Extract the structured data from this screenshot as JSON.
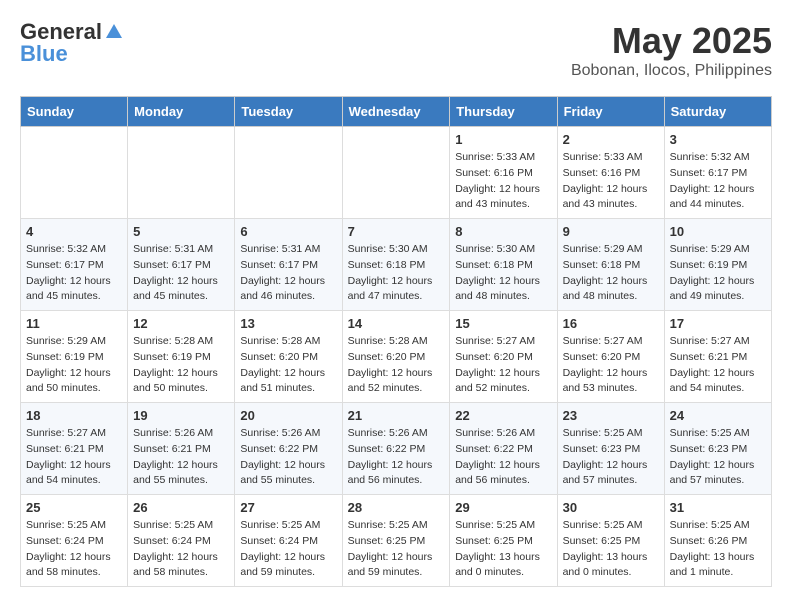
{
  "header": {
    "logo_line1": "General",
    "logo_line2": "Blue",
    "month_title": "May 2025",
    "location": "Bobonan, Ilocos, Philippines"
  },
  "days_of_week": [
    "Sunday",
    "Monday",
    "Tuesday",
    "Wednesday",
    "Thursday",
    "Friday",
    "Saturday"
  ],
  "weeks": [
    [
      {
        "day": "",
        "detail": ""
      },
      {
        "day": "",
        "detail": ""
      },
      {
        "day": "",
        "detail": ""
      },
      {
        "day": "",
        "detail": ""
      },
      {
        "day": "1",
        "detail": "Sunrise: 5:33 AM\nSunset: 6:16 PM\nDaylight: 12 hours\nand 43 minutes."
      },
      {
        "day": "2",
        "detail": "Sunrise: 5:33 AM\nSunset: 6:16 PM\nDaylight: 12 hours\nand 43 minutes."
      },
      {
        "day": "3",
        "detail": "Sunrise: 5:32 AM\nSunset: 6:17 PM\nDaylight: 12 hours\nand 44 minutes."
      }
    ],
    [
      {
        "day": "4",
        "detail": "Sunrise: 5:32 AM\nSunset: 6:17 PM\nDaylight: 12 hours\nand 45 minutes."
      },
      {
        "day": "5",
        "detail": "Sunrise: 5:31 AM\nSunset: 6:17 PM\nDaylight: 12 hours\nand 45 minutes."
      },
      {
        "day": "6",
        "detail": "Sunrise: 5:31 AM\nSunset: 6:17 PM\nDaylight: 12 hours\nand 46 minutes."
      },
      {
        "day": "7",
        "detail": "Sunrise: 5:30 AM\nSunset: 6:18 PM\nDaylight: 12 hours\nand 47 minutes."
      },
      {
        "day": "8",
        "detail": "Sunrise: 5:30 AM\nSunset: 6:18 PM\nDaylight: 12 hours\nand 48 minutes."
      },
      {
        "day": "9",
        "detail": "Sunrise: 5:29 AM\nSunset: 6:18 PM\nDaylight: 12 hours\nand 48 minutes."
      },
      {
        "day": "10",
        "detail": "Sunrise: 5:29 AM\nSunset: 6:19 PM\nDaylight: 12 hours\nand 49 minutes."
      }
    ],
    [
      {
        "day": "11",
        "detail": "Sunrise: 5:29 AM\nSunset: 6:19 PM\nDaylight: 12 hours\nand 50 minutes."
      },
      {
        "day": "12",
        "detail": "Sunrise: 5:28 AM\nSunset: 6:19 PM\nDaylight: 12 hours\nand 50 minutes."
      },
      {
        "day": "13",
        "detail": "Sunrise: 5:28 AM\nSunset: 6:20 PM\nDaylight: 12 hours\nand 51 minutes."
      },
      {
        "day": "14",
        "detail": "Sunrise: 5:28 AM\nSunset: 6:20 PM\nDaylight: 12 hours\nand 52 minutes."
      },
      {
        "day": "15",
        "detail": "Sunrise: 5:27 AM\nSunset: 6:20 PM\nDaylight: 12 hours\nand 52 minutes."
      },
      {
        "day": "16",
        "detail": "Sunrise: 5:27 AM\nSunset: 6:20 PM\nDaylight: 12 hours\nand 53 minutes."
      },
      {
        "day": "17",
        "detail": "Sunrise: 5:27 AM\nSunset: 6:21 PM\nDaylight: 12 hours\nand 54 minutes."
      }
    ],
    [
      {
        "day": "18",
        "detail": "Sunrise: 5:27 AM\nSunset: 6:21 PM\nDaylight: 12 hours\nand 54 minutes."
      },
      {
        "day": "19",
        "detail": "Sunrise: 5:26 AM\nSunset: 6:21 PM\nDaylight: 12 hours\nand 55 minutes."
      },
      {
        "day": "20",
        "detail": "Sunrise: 5:26 AM\nSunset: 6:22 PM\nDaylight: 12 hours\nand 55 minutes."
      },
      {
        "day": "21",
        "detail": "Sunrise: 5:26 AM\nSunset: 6:22 PM\nDaylight: 12 hours\nand 56 minutes."
      },
      {
        "day": "22",
        "detail": "Sunrise: 5:26 AM\nSunset: 6:22 PM\nDaylight: 12 hours\nand 56 minutes."
      },
      {
        "day": "23",
        "detail": "Sunrise: 5:25 AM\nSunset: 6:23 PM\nDaylight: 12 hours\nand 57 minutes."
      },
      {
        "day": "24",
        "detail": "Sunrise: 5:25 AM\nSunset: 6:23 PM\nDaylight: 12 hours\nand 57 minutes."
      }
    ],
    [
      {
        "day": "25",
        "detail": "Sunrise: 5:25 AM\nSunset: 6:24 PM\nDaylight: 12 hours\nand 58 minutes."
      },
      {
        "day": "26",
        "detail": "Sunrise: 5:25 AM\nSunset: 6:24 PM\nDaylight: 12 hours\nand 58 minutes."
      },
      {
        "day": "27",
        "detail": "Sunrise: 5:25 AM\nSunset: 6:24 PM\nDaylight: 12 hours\nand 59 minutes."
      },
      {
        "day": "28",
        "detail": "Sunrise: 5:25 AM\nSunset: 6:25 PM\nDaylight: 12 hours\nand 59 minutes."
      },
      {
        "day": "29",
        "detail": "Sunrise: 5:25 AM\nSunset: 6:25 PM\nDaylight: 13 hours\nand 0 minutes."
      },
      {
        "day": "30",
        "detail": "Sunrise: 5:25 AM\nSunset: 6:25 PM\nDaylight: 13 hours\nand 0 minutes."
      },
      {
        "day": "31",
        "detail": "Sunrise: 5:25 AM\nSunset: 6:26 PM\nDaylight: 13 hours\nand 1 minute."
      }
    ]
  ]
}
